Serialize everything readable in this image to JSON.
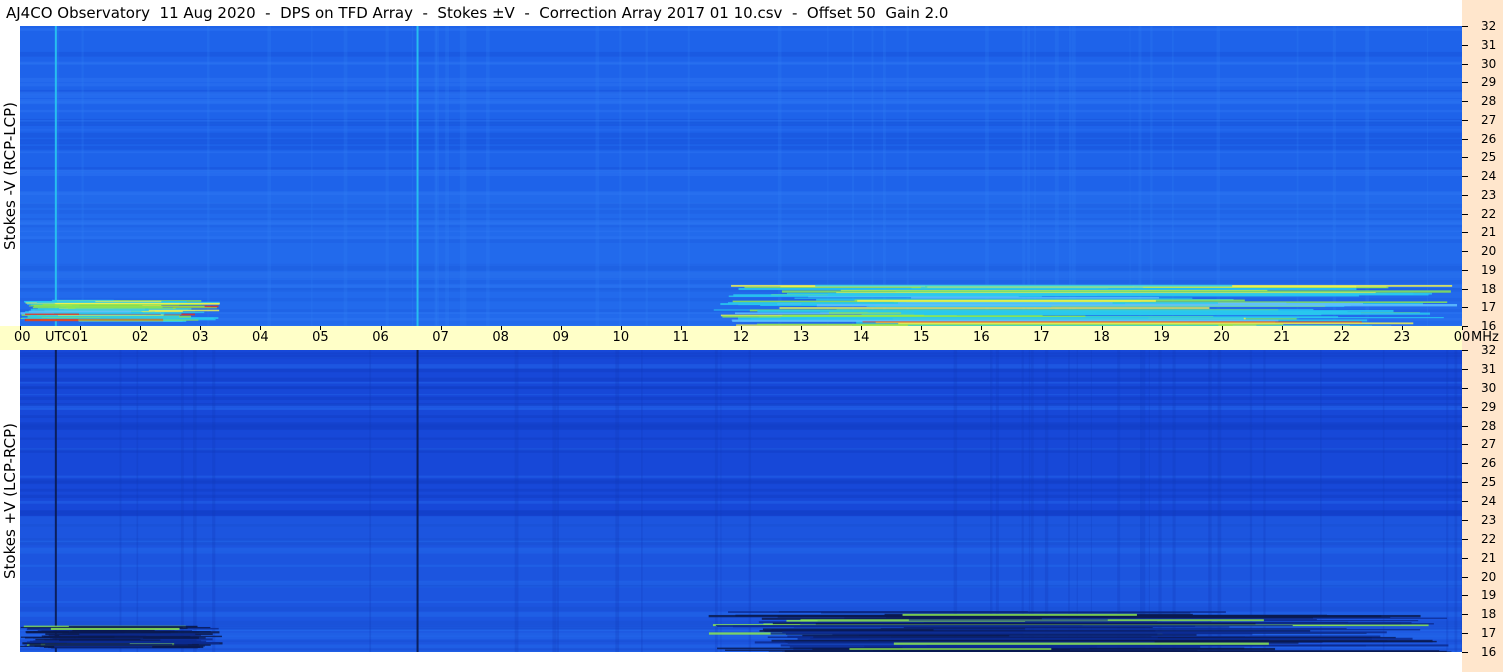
{
  "title": "AJ4CO Observatory  11 Aug 2020  -  DPS on TFD Array  -  Stokes ±V  -  Correction Array 2017 01 10.csv  -  Offset 50  Gain 2.0",
  "utc_label": "UTC",
  "unit_label": "MHz",
  "colors": {
    "background": "#1a5fe6",
    "band": "#ffffc8",
    "right_strip": "#ffe6cc",
    "cyan": "#28c8f0",
    "green": "#8ce650",
    "yellow": "#f0f050",
    "red": "#e03020",
    "dark": "#0a1a50"
  },
  "chart_data": [
    {
      "type": "heatmap",
      "title": "Stokes -V (RCP-LCP)",
      "ylabel": "Stokes -V (RCP-LCP)",
      "xlabel": "UTC",
      "x_range_hours": [
        0,
        24
      ],
      "x_ticks": [
        "00",
        "01",
        "02",
        "03",
        "04",
        "05",
        "06",
        "07",
        "08",
        "09",
        "10",
        "11",
        "12",
        "13",
        "14",
        "15",
        "16",
        "17",
        "18",
        "19",
        "20",
        "21",
        "22",
        "23",
        "00"
      ],
      "y_range_mhz": [
        16,
        32
      ],
      "y_ticks": [
        32,
        31,
        30,
        29,
        28,
        27,
        26,
        25,
        24,
        23,
        22,
        21,
        20,
        19,
        18,
        17,
        16
      ],
      "y_unit": "MHz",
      "features": [
        {
          "kind": "vline",
          "hour": 0.58,
          "color": "cyan"
        },
        {
          "kind": "vline",
          "hour": 6.6,
          "color": "cyan"
        },
        {
          "kind": "burst",
          "start_hour": 11.45,
          "end_hour": 24.0,
          "mhz_low": 16.0,
          "mhz_high": 18.2,
          "color": "cyan"
        },
        {
          "kind": "burst",
          "start_hour": 0.0,
          "end_hour": 3.4,
          "mhz_low": 16.3,
          "mhz_high": 17.4,
          "color": "cyan"
        }
      ]
    },
    {
      "type": "heatmap",
      "title": "Stokes +V (LCP-RCP)",
      "ylabel": "Stokes +V (LCP-RCP)",
      "xlabel": "UTC",
      "x_range_hours": [
        0,
        24
      ],
      "x_ticks": [
        "00",
        "01",
        "02",
        "03",
        "04",
        "05",
        "06",
        "07",
        "08",
        "09",
        "10",
        "11",
        "12",
        "13",
        "14",
        "15",
        "16",
        "17",
        "18",
        "19",
        "20",
        "21",
        "22",
        "23",
        "00"
      ],
      "y_range_mhz": [
        16,
        32
      ],
      "y_ticks": [
        32,
        31,
        30,
        29,
        28,
        27,
        26,
        25,
        24,
        23,
        22,
        21,
        20,
        19,
        18,
        17,
        16
      ],
      "y_unit": "MHz",
      "features": [
        {
          "kind": "vline",
          "hour": 0.58,
          "color": "dark"
        },
        {
          "kind": "vline",
          "hour": 6.6,
          "color": "dark"
        },
        {
          "kind": "burst",
          "start_hour": 11.45,
          "end_hour": 24.0,
          "mhz_low": 16.0,
          "mhz_high": 18.2,
          "color": "dark"
        },
        {
          "kind": "burst",
          "start_hour": 0.0,
          "end_hour": 3.4,
          "mhz_low": 16.3,
          "mhz_high": 17.4,
          "color": "dark"
        }
      ]
    }
  ]
}
